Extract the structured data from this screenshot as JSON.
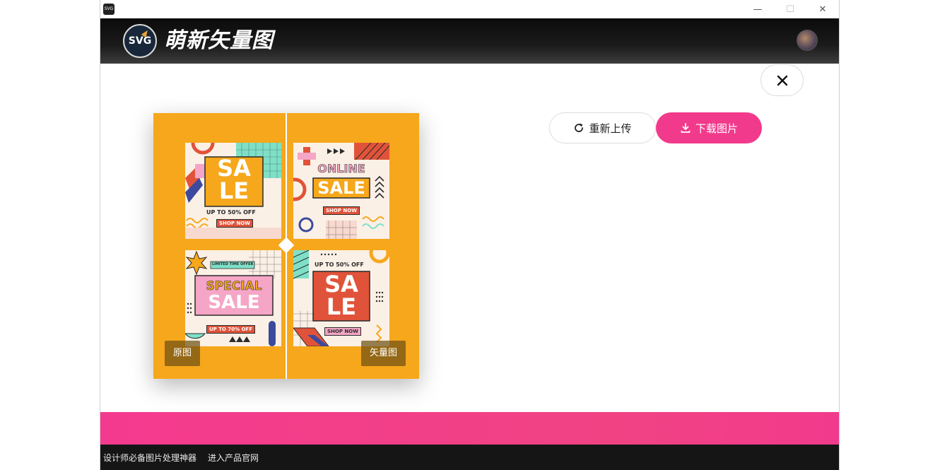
{
  "window": {
    "app_icon_text": "SVG",
    "minimize": "—",
    "maximize": "☐",
    "close": "✕"
  },
  "header": {
    "logo_mark": "SVG",
    "title": "萌新矢量图"
  },
  "preview": {
    "label_left": "原图",
    "label_right": "矢量图",
    "cards": {
      "c1": {
        "big1": "SA",
        "big2": "LE",
        "sub": "UP TO 50% OFF",
        "btn": "SHOP NOW"
      },
      "c2": {
        "top": "ONLINE",
        "big": "SALE",
        "btn": "SHOP NOW"
      },
      "c3": {
        "badge": "LIMITED TIME OFFER",
        "big1": "SPECIAL",
        "big2": "SALE",
        "btn": "UP TO 70% OFF"
      },
      "c4": {
        "sub": "UP TO 50% OFF",
        "big1": "SA",
        "big2": "LE",
        "btn": "SHOP NOW"
      }
    }
  },
  "actions": {
    "reupload": "重新上传",
    "download": "下载图片"
  },
  "footer": {
    "link1": "设计师必备图片处理神器",
    "link2": "进入产品官网"
  },
  "colors": {
    "accent": "#f23a8c",
    "preview_bg": "#f6a71b",
    "header_bg": "#141414"
  }
}
